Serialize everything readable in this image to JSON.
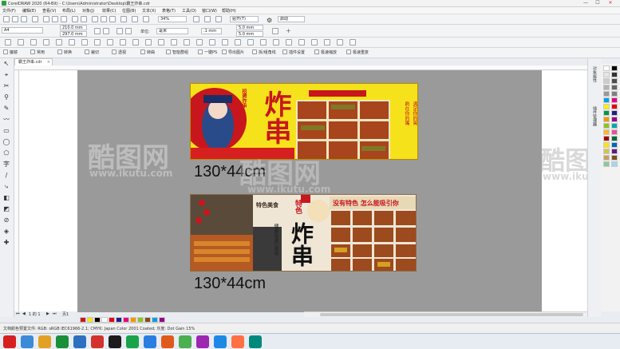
{
  "window": {
    "title": "CorelDRAW 2020 (64-Bit) - C:\\Users\\Administrator\\Desktop\\霸王炸串.cdr",
    "minimize": "—",
    "maximize": "☐",
    "close": "✕"
  },
  "menu": [
    "文件(F)",
    "编辑(E)",
    "查看(V)",
    "布局(L)",
    "对象(J)",
    "效果(C)",
    "位图(B)",
    "文本(X)",
    "表格(T)",
    "工具(O)",
    "窗口(W)",
    "帮助(H)"
  ],
  "toolbar": {
    "zoom": "34%",
    "snap_label": "贴齐(T)",
    "launch_label": "启动"
  },
  "property_bar": {
    "page_size": "A4",
    "width": "210.0 mm",
    "height": "297.0 mm",
    "unit_label": "单位:",
    "unit_value": "毫米",
    "nudge": ".1 mm",
    "dup_x": "5.0 mm",
    "dup_y": "5.0 mm"
  },
  "plugins": [
    "魔镜",
    "常用",
    "转换",
    "裁切",
    "透视",
    "转曲",
    "智能群组",
    "一键PS",
    "导出图片",
    "拆/组角线",
    "插件设置",
    "极速缩放",
    "极速重复"
  ],
  "document_tab": "霸王炸串.cdr",
  "captions": {
    "first": "130*44cm",
    "second": "130*44cm"
  },
  "banner1": {
    "headline": "炸串",
    "tag_left": "招牌炸串",
    "side_text_1": "刷在你的嘴",
    "side_text_2": "满足你的胃"
  },
  "banner2": {
    "label_top": "特色美食",
    "headline": "炸串",
    "subtitle": "特色",
    "strip_text": "没有特色 怎么能吸引你",
    "tagline": "健康/营养/美味"
  },
  "dockers": [
    "对象属性",
    "插件管理器"
  ],
  "status": {
    "page_indicator": "1 的 1",
    "page_name": "页1",
    "hint": "文档颜色预置文件: RGB: sRGB IEC61966-2.1; CMYK: Japan Color 2001 Coated; 灰度: Dot Gain 15%"
  },
  "watermark": {
    "brand": "酷图网",
    "url": "www.ikutu.com"
  },
  "colors": {
    "banner_yellow": "#f6e21a",
    "banner_red": "#c8161d",
    "page_gray": "#9a9a9a"
  }
}
